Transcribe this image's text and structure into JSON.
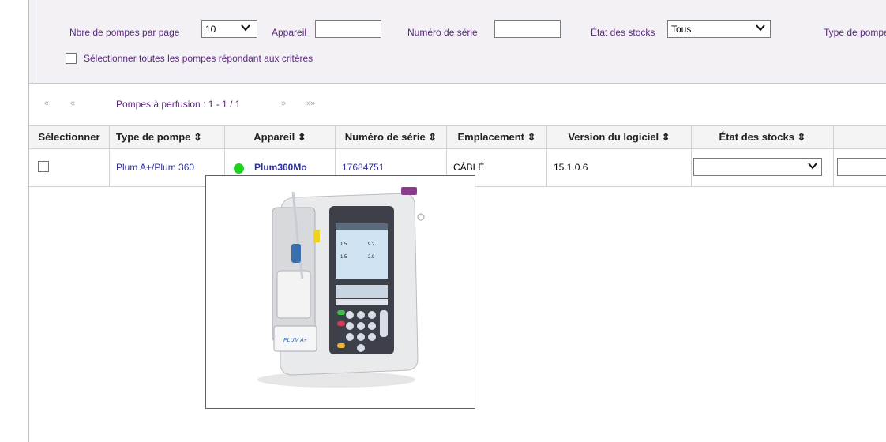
{
  "filters": {
    "per_page_label": "Nbre de pompes par page",
    "per_page_value": "10",
    "device_label": "Appareil",
    "device_value": "",
    "serial_label": "Numéro de série",
    "serial_value": "",
    "stock_label": "État des stocks",
    "stock_value": "Tous",
    "pump_type_label": "Type de pompe",
    "select_all_label": "Sélectionner toutes les pompes répondant aux critères"
  },
  "pager": {
    "first": "«",
    "prev": "«",
    "text": "Pompes à perfusion : 1 - 1 / 1",
    "next": "»",
    "last": "»»"
  },
  "table": {
    "columns": [
      "Sélectionner",
      "Type de pompe ⇕",
      "Appareil ⇕",
      "Numéro de série ⇕",
      "Emplacement ⇕",
      "Version du logiciel ⇕",
      "État des stocks ⇕",
      ""
    ],
    "rows": [
      {
        "selected": false,
        "pump_type": "Plum A+/Plum 360",
        "device": "Plum360Mo",
        "device_status_color": "#1fd11f",
        "serial": "17684751",
        "location": "CÂBLÉ",
        "software_version": "15.1.0.6",
        "stock_state": ""
      }
    ]
  },
  "popup": {
    "device_brand": "PLUM A+",
    "screen_lines": [
      "1.5",
      "9.2",
      "1.5",
      "2.9"
    ]
  },
  "colors": {
    "label_purple": "#5b2a7e",
    "link_blue": "#2b2f9e",
    "status_green": "#1fd11f"
  }
}
